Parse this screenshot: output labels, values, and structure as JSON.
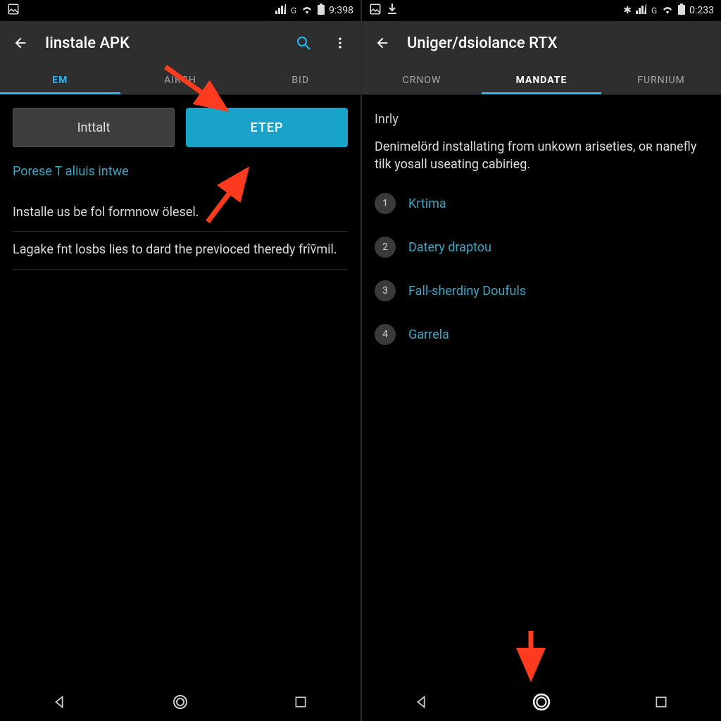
{
  "left": {
    "status": {
      "time": "9:398"
    },
    "appbar": {
      "title": "Iinstale APK"
    },
    "tabs": [
      "EM",
      "AIRCH",
      "BID"
    ],
    "active_tab_index": 0,
    "buttons": {
      "secondary": "Inttalt",
      "primary": "ETEP"
    },
    "link": "Porese T aliuis intwe",
    "para1": "Installe us be fol formnow ölesel.",
    "para2": "Lagake fnt losbs lies to dard the previoced theredy frîṽmil."
  },
  "right": {
    "status": {
      "time": "0:233"
    },
    "appbar": {
      "title": "Uniger/dsiolance RTX"
    },
    "tabs": [
      "CRNOW",
      "MANDATE",
      "FURNIUM"
    ],
    "active_tab_index": 1,
    "section_head": "Inrly",
    "desc": "Denimelörd installating from unkown ariseties, oʀ nanefly tilk yosall useating cabirieg.",
    "steps": [
      "Krtima",
      "Datery draptou",
      "Fall-sherdiny Doufuls",
      "Garrela"
    ]
  },
  "colors": {
    "accent": "#29b6f6",
    "link": "#3ba5c4",
    "primary_btn": "#1aa3c9"
  }
}
